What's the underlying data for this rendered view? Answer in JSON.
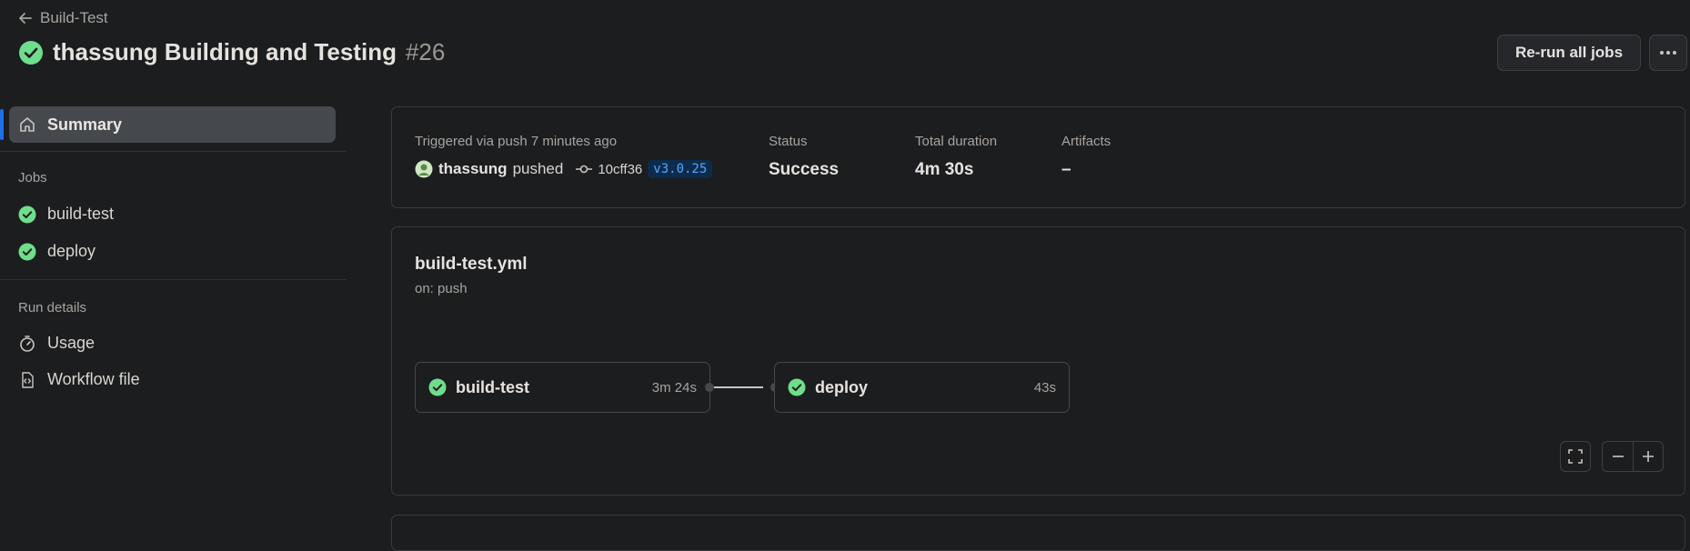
{
  "header": {
    "back_label": "Build-Test",
    "title": "thassung Building and Testing",
    "run_number": "#26",
    "rerun_label": "Re-run all jobs",
    "more_label": "···"
  },
  "sidebar": {
    "summary_label": "Summary",
    "jobs_heading": "Jobs",
    "jobs": [
      {
        "label": "build-test"
      },
      {
        "label": "deploy"
      }
    ],
    "run_details_heading": "Run details",
    "run_details": [
      {
        "label": "Usage",
        "icon": "stopwatch-icon"
      },
      {
        "label": "Workflow file",
        "icon": "file-code-icon"
      }
    ]
  },
  "summary": {
    "trigger_label": "Triggered via push 7 minutes ago",
    "actor": "thassung",
    "action": "pushed",
    "commit": "10cff36",
    "tag": "v3.0.25",
    "status_label": "Status",
    "status_value": "Success",
    "duration_label": "Total duration",
    "duration_value": "4m 30s",
    "artifacts_label": "Artifacts",
    "artifacts_value": "–"
  },
  "workflow": {
    "file": "build-test.yml",
    "trigger": "on: push",
    "jobs": [
      {
        "name": "build-test",
        "duration": "3m 24s"
      },
      {
        "name": "deploy",
        "duration": "43s"
      }
    ]
  },
  "colors": {
    "success": "#6fdd8b",
    "accent": "#1f6feb",
    "background": "#1c1d1f"
  }
}
